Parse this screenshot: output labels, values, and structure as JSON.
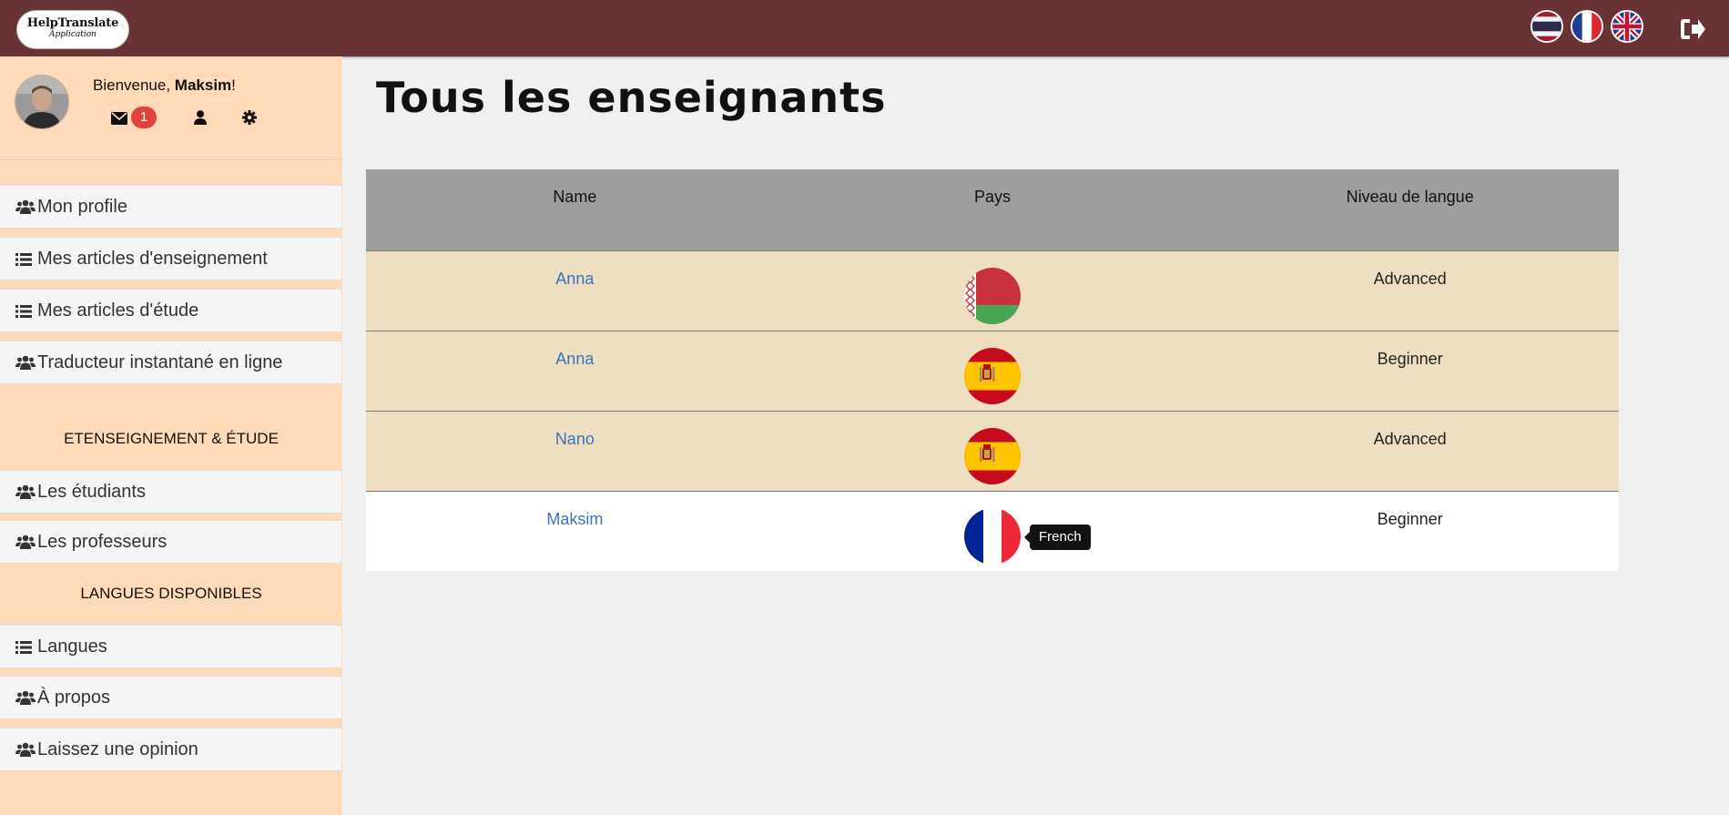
{
  "header": {
    "logo_line1": "HelpTranslate",
    "logo_line2": "Application",
    "languages": [
      {
        "icon": "thai-flag-icon",
        "lang": "th"
      },
      {
        "icon": "french-flag-icon",
        "lang": "fr"
      },
      {
        "icon": "uk-flag-icon",
        "lang": "en"
      }
    ],
    "logout_icon": "sign-out-icon",
    "bar_color": "#693335"
  },
  "user": {
    "greeting": "Bienvenue, ",
    "name": "Maksim",
    "exclamation": "!",
    "messages_count": "1",
    "icons": [
      "envelope-icon",
      "user-icon",
      "gear-icon"
    ]
  },
  "sidebar": {
    "items_top": [
      {
        "icon": "users-icon",
        "label": "Mon profile"
      },
      {
        "icon": "list-icon",
        "label": "Mes articles d'enseignement"
      },
      {
        "icon": "list-icon",
        "label": "Mes articles d'étude"
      },
      {
        "icon": "users-icon",
        "label": "Traducteur instantané en ligne"
      }
    ],
    "section1": "ETENSEIGNEMENT & ÉTUDE",
    "items_mid": [
      {
        "icon": "users-icon",
        "label": "Les étudiants"
      },
      {
        "icon": "users-icon",
        "label": "Les professeurs"
      }
    ],
    "section2": "LANGUES DISPONIBLES",
    "items_bottom": [
      {
        "icon": "list-icon",
        "label": "Langues"
      },
      {
        "icon": "users-icon",
        "label": "À propos"
      },
      {
        "icon": "users-icon",
        "label": "Laissez une opinion"
      }
    ],
    "background": "#ffdab8"
  },
  "main": {
    "title": "Tous les enseignants",
    "columns": [
      "Name",
      "Pays",
      "Niveau de langue"
    ],
    "rows": [
      {
        "name": "Anna",
        "country_flag": "belarus-flag-icon",
        "level": "Advanced"
      },
      {
        "name": "Anna",
        "country_flag": "spain-flag-icon",
        "level": "Beginner"
      },
      {
        "name": "Nano",
        "country_flag": "spain-flag-icon",
        "level": "Advanced"
      },
      {
        "name": "Maksim",
        "country_flag": "france-flag-icon",
        "level": "Beginner"
      }
    ],
    "tooltip": "French"
  }
}
